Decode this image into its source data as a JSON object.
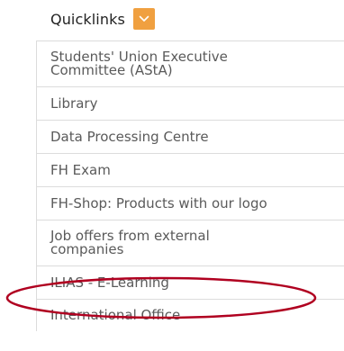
{
  "quicklinks": {
    "title": "Quicklinks",
    "toggle_icon": "chevron-down-icon",
    "accent_color": "#f0a040",
    "items": [
      {
        "label": "Students' Union Executive Committee (AStA)"
      },
      {
        "label": "Library"
      },
      {
        "label": "Data Processing Centre"
      },
      {
        "label": "FH Exam"
      },
      {
        "label": "FH-Shop: Products with our logo"
      },
      {
        "label": "Job offers from external companies"
      },
      {
        "label": "ILIAS - E-Learning"
      },
      {
        "label": "International Office"
      }
    ]
  },
  "annotation": {
    "highlighted_item": "ILIAS - E-Learning",
    "ring_color": "#b00020"
  }
}
